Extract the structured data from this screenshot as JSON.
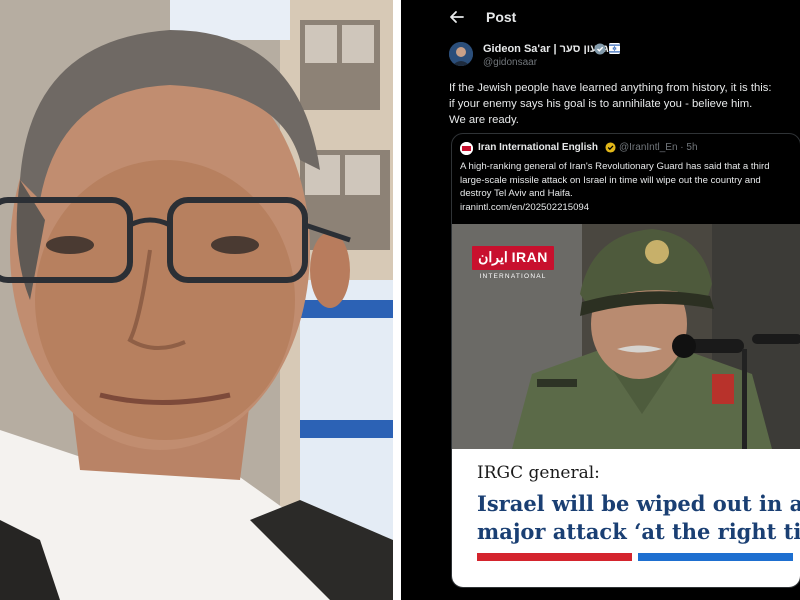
{
  "topbar": {
    "title": "Post"
  },
  "author": {
    "name": "Gideon Sa'ar | גדעון סער",
    "handle": "@gidonsaar"
  },
  "post": {
    "lines": [
      "If the Jewish people have learned anything from history, it is this:",
      "if your enemy says his goal is to annihilate you - believe him.",
      "We are ready."
    ]
  },
  "quote": {
    "name": "Iran International English",
    "handle_time": "@IranIntl_En · 5h",
    "lines": [
      "A high-ranking general of Iran's Revolutionary Guard has said that a third",
      "large-scale missile attack on Israel in time will wipe out the country and",
      "destroy Tel Aviv and Haifa.",
      "iranintl.com/en/202502215094"
    ],
    "logo": {
      "main": "ایران IRAN",
      "sub": "INTERNATIONAL"
    },
    "headline": {
      "kicker": "IRGC general:",
      "lines": [
        "Israel will be wiped out in a",
        "major attack ‘at the right time’"
      ]
    }
  },
  "colors": {
    "background": "#000000",
    "text_primary": "#e7e9ea",
    "text_secondary": "#71767b",
    "verified": "#1d9bf0",
    "headline_blue": "#1a3f73",
    "accent_red": "#d4242d",
    "accent_blue": "#1e6fd0"
  },
  "icons": {
    "back": "arrow-left-icon",
    "verified": "verified-badge-icon",
    "affiliation": "affiliation-flag-icon"
  }
}
